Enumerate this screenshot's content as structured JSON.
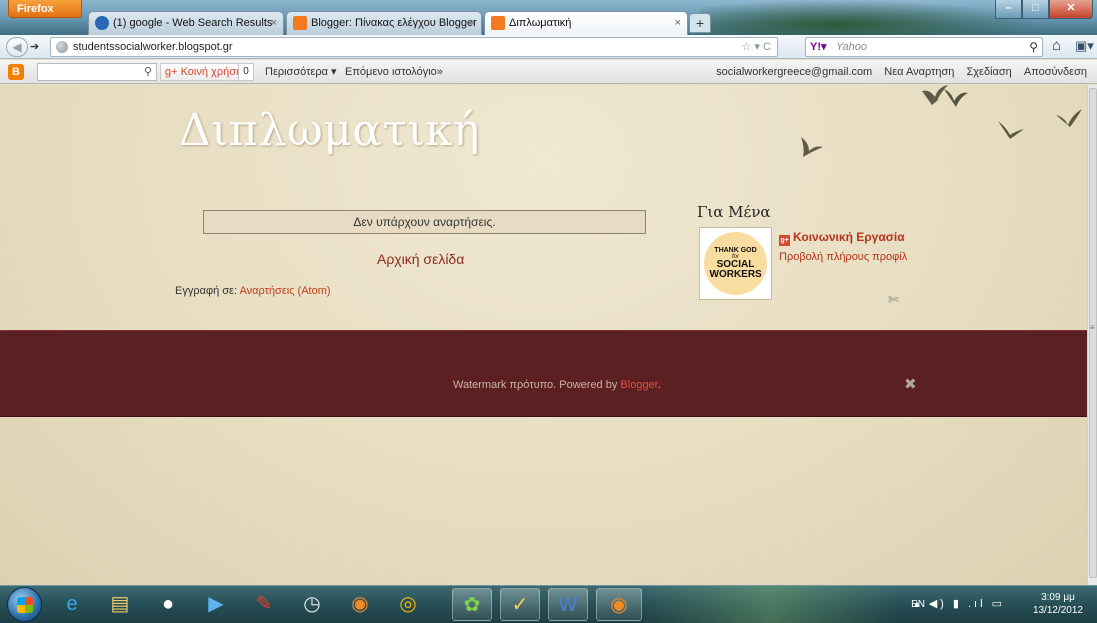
{
  "browser": {
    "menu_label": "Firefox",
    "tabs": [
      {
        "title": "(1) google - Web Search Results",
        "icon": "google-favicon"
      },
      {
        "title": "Blogger: Πίνακας ελέγχου Blogger",
        "icon": "blogger-favicon"
      },
      {
        "title": "Διπλωματική",
        "icon": "blogger-favicon"
      }
    ],
    "url": "studentssocialworker.blogspot.gr",
    "search_engine": "Yahoo"
  },
  "blogger_bar": {
    "gplus_label": "Κοινή χρήση",
    "gplus_count": "0",
    "more": "Περισσότερα ▾",
    "next_blog": "Επόμενο ιστολόγιο»",
    "email": "socialworkergreece@gmail.com",
    "new_post": "Νεα Αναρτηση",
    "design": "Σχεδίαση",
    "sign_out": "Αποσύνδεση"
  },
  "blog": {
    "title": "Διπλωματική",
    "no_posts": "Δεν υπάρχουν αναρτήσεις.",
    "home_link": "Αρχική σελίδα",
    "subscribe_label": "Εγγραφή σε:",
    "subscribe_link": "Αναρτήσεις (Atom)",
    "about_title": "Για Μένα",
    "profile_name": "Κοινωνική Εργασία",
    "profile_view": "Προβολή πλήρους προφίλ",
    "profile_image_lines": [
      "THANK GOD",
      "for",
      "SOCIAL WORKERS"
    ],
    "footer_text": "Watermark πρότυπο. Powered by",
    "footer_link": "Blogger",
    "footer_end": "."
  },
  "taskbar": {
    "items": [
      "ie-icon",
      "explorer-icon",
      "user-icon",
      "media-icon",
      "pin-icon",
      "clock-icon",
      "firefox-icon",
      "chrome-icon",
      "messenger-icon",
      "paint-icon",
      "word-icon",
      "firefox-active-icon"
    ],
    "lang": "EN",
    "time": "3:09 μμ",
    "date": "13/12/2012"
  },
  "colors": {
    "accent_link": "#c23a14",
    "footer_bg": "#5c1f22",
    "page_bg": "#e7ddc1"
  }
}
